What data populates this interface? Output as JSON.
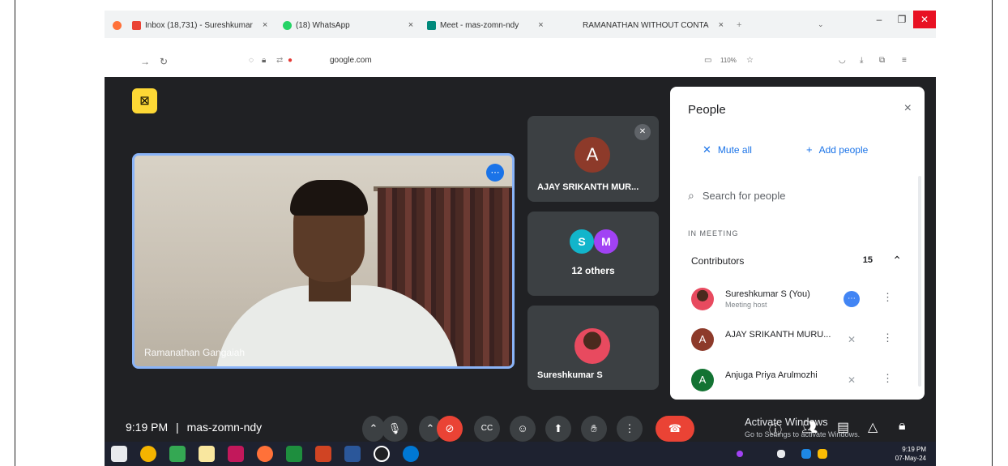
{
  "tabs": [
    {
      "title": "Inbox (18,731) - Sureshkumar",
      "icon": "gmail-icon",
      "close": "×"
    },
    {
      "title": "(18) WhatsApp",
      "icon": "whatsapp-icon",
      "close": "×"
    },
    {
      "title": "Meet - mas-zomn-ndy",
      "icon": "meet-icon",
      "close": "×"
    },
    {
      "title": "RAMANATHAN WITHOUT CONTA",
      "icon": "doc-icon",
      "close": "×"
    }
  ],
  "new_tab": "+",
  "window_controls": {
    "minimize": "–",
    "restore": "❐",
    "close": "✕"
  },
  "url": {
    "domain": "google.com",
    "zoom": "110%"
  },
  "meeting": {
    "main_participant": "Ramanathan Gangaiah",
    "side_tiles": [
      {
        "initial": "A",
        "name": "AJAY SRIKANTH MUR...",
        "avatar_color": "#8d3a2a"
      },
      {
        "initials": [
          "S",
          "M"
        ],
        "label": "12 others",
        "avatar_colors": [
          "#12b5cb",
          "#a142f4"
        ]
      },
      {
        "name": "Sureshkumar S"
      }
    ]
  },
  "people_panel": {
    "title": "People",
    "close": "×",
    "mute_all": "Mute all",
    "add_people": "Add people",
    "search_placeholder": "Search for people",
    "section_label": "IN MEETING",
    "group_label": "Contributors",
    "group_count": "15",
    "participants": [
      {
        "name": "Sureshkumar S (You)",
        "subtitle": "Meeting host",
        "avatar": "photo",
        "avatar_color": "#e84a5f",
        "status": "speaking-icon"
      },
      {
        "name": "AJAY SRIKANTH MURU...",
        "initial": "A",
        "avatar_color": "#8d3a2a",
        "status": "mic-off-icon"
      },
      {
        "name": "Anjuga Priya Arulmozhi",
        "initial": "A",
        "avatar_color": "#137333",
        "status": "mic-off-icon"
      }
    ]
  },
  "bottom_bar": {
    "time": "9:19 PM",
    "separator": "|",
    "meeting_code": "mas-zomn-ndy"
  },
  "windows_watermark": {
    "title": "Activate Windows",
    "subtitle": "Go to Settings to activate Windows."
  },
  "taskbar": {
    "time": "9:19 PM",
    "date": "07-May-24"
  }
}
